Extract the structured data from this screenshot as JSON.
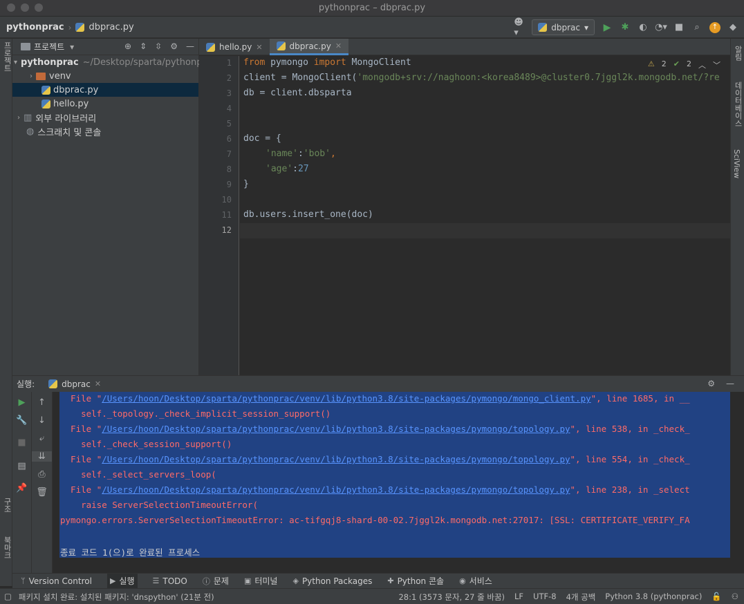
{
  "window": {
    "title": "pythonprac – dbprac.py"
  },
  "navbar": {
    "project": "pythonprac",
    "file": "dbprac.py",
    "run_config": "dbprac"
  },
  "left_stripe": {
    "project_label": "프로젝트",
    "structure_label": "구조",
    "bookmarks_label": "북마크"
  },
  "right_stripe": {
    "notifications_label": "알림",
    "database_label": "데이터베이스",
    "sciview_label": "SciView"
  },
  "project_panel": {
    "title": "프로젝트",
    "root_name": "pythonprac",
    "root_path": "~/Desktop/sparta/pythonprac",
    "items": [
      {
        "label": "venv"
      },
      {
        "label": "dbprac.py"
      },
      {
        "label": "hello.py"
      },
      {
        "label": "외부 라이브러리"
      },
      {
        "label": "스크래치 및 콘솔"
      }
    ]
  },
  "editor": {
    "tabs": [
      {
        "label": "hello.py"
      },
      {
        "label": "dbprac.py"
      }
    ],
    "inspections": {
      "warnings": "2",
      "weak_warnings": "2"
    },
    "line_numbers": [
      "1",
      "2",
      "3",
      "4",
      "5",
      "6",
      "7",
      "8",
      "9",
      "10",
      "11",
      "12"
    ],
    "code": {
      "l1_from": "from",
      "l1_mod": " pymongo ",
      "l1_import": "import",
      "l1_cls": " MongoClient",
      "l2_a": "client = MongoClient(",
      "l2_str": "'mongodb+srv://naghoon:<korea8489>@cluster0.7jggl2k.mongodb.net/?re",
      "l3": "db = client.dbsparta",
      "l6": "doc = {",
      "l7_key": "'name'",
      "l7_colon": ":",
      "l7_val": "'bob'",
      "l7_end": ",",
      "l8_key": "'age'",
      "l8_colon": ":",
      "l8_val": "27",
      "l9": "}",
      "l11": "db.users.insert_one(doc)"
    }
  },
  "run_panel": {
    "label": "실행:",
    "tab": "dbprac",
    "lines": [
      {
        "pre": "  File \"",
        "link": "/Users/hoon/Desktop/sparta/pythonprac/venv/lib/python3.8/site-packages/pymongo/mongo_client.py",
        "post": "\", line 1685, in __"
      },
      {
        "text": "    self._topology._check_implicit_session_support()"
      },
      {
        "pre": "  File \"",
        "link": "/Users/hoon/Desktop/sparta/pythonprac/venv/lib/python3.8/site-packages/pymongo/topology.py",
        "post": "\", line 538, in _check_"
      },
      {
        "text": "    self._check_session_support()"
      },
      {
        "pre": "  File \"",
        "link": "/Users/hoon/Desktop/sparta/pythonprac/venv/lib/python3.8/site-packages/pymongo/topology.py",
        "post": "\", line 554, in _check_"
      },
      {
        "text": "    self._select_servers_loop("
      },
      {
        "pre": "  File \"",
        "link": "/Users/hoon/Desktop/sparta/pythonprac/venv/lib/python3.8/site-packages/pymongo/topology.py",
        "post": "\", line 238, in _select"
      },
      {
        "text": "    raise ServerSelectionTimeoutError("
      },
      {
        "text": "pymongo.errors.ServerSelectionTimeoutError: ac-tifgqj8-shard-00-02.7jggl2k.mongodb.net:27017: [SSL: CERTIFICATE_VERIFY_FA"
      },
      {
        "text": ""
      },
      {
        "text": "종료 코드 1(으)로 완료된 프로세스"
      }
    ]
  },
  "tool_windows": [
    {
      "label": "Version Control"
    },
    {
      "label": "실행"
    },
    {
      "label": "TODO"
    },
    {
      "label": "문제"
    },
    {
      "label": "터미널"
    },
    {
      "label": "Python Packages"
    },
    {
      "label": "Python 콘솔"
    },
    {
      "label": "서비스"
    }
  ],
  "status_bar": {
    "message": "패키지 설치 완료: 설치된 패키지: 'dnspython' (21분 전)",
    "position": "28:1 (3573 문자, 27 줄 바꿈)",
    "line_sep": "LF",
    "encoding": "UTF-8",
    "indent": "4개 공백",
    "interpreter": "Python 3.8 (pythonprac)"
  },
  "colors": {
    "selection": "#214283",
    "error": "#ff6b68",
    "link": "#5894ff",
    "keyword": "#cc7832",
    "string": "#6a8759",
    "number": "#6897bb"
  }
}
